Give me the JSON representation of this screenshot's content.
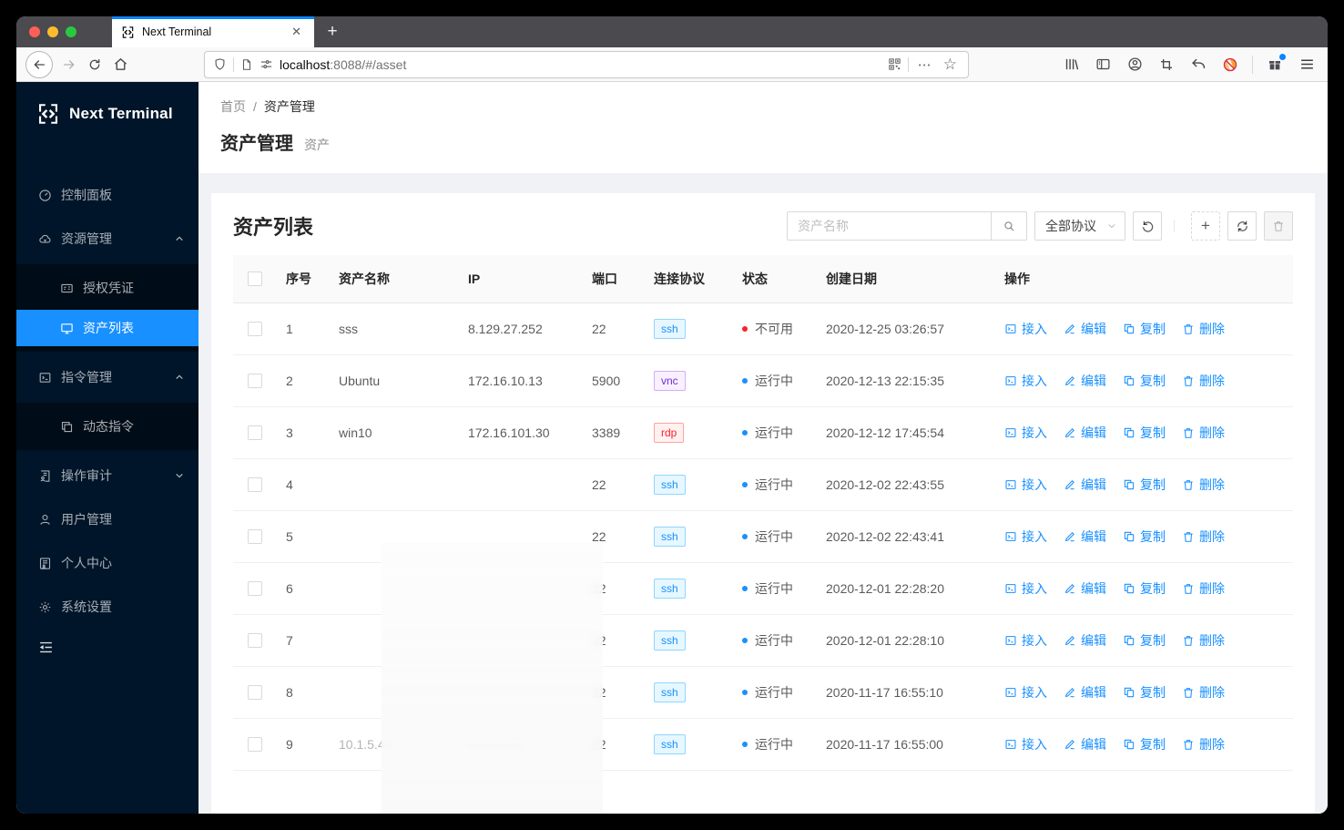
{
  "browser": {
    "tab_title": "Next Terminal",
    "url_host": "localhost",
    "url_rest": ":8088/#/asset"
  },
  "icons": {
    "close": "✕",
    "new_tab": "+",
    "more": "⋯",
    "star": "☆",
    "plus": "+"
  },
  "sidebar": {
    "logo_text": "Next Terminal",
    "items": [
      {
        "label": "控制面板"
      },
      {
        "label": "资源管理"
      },
      {
        "label": "授权凭证"
      },
      {
        "label": "资产列表"
      },
      {
        "label": "指令管理"
      },
      {
        "label": "动态指令"
      },
      {
        "label": "操作审计"
      },
      {
        "label": "用户管理"
      },
      {
        "label": "个人中心"
      },
      {
        "label": "系统设置"
      }
    ]
  },
  "breadcrumb": {
    "home": "首页",
    "separator": "/",
    "current": "资产管理"
  },
  "page_header": {
    "title": "资产管理",
    "subtitle": "资产"
  },
  "card": {
    "title": "资产列表",
    "search_placeholder": "资产名称",
    "protocol_filter": "全部协议"
  },
  "table": {
    "columns": [
      "序号",
      "资产名称",
      "IP",
      "端口",
      "连接协议",
      "状态",
      "创建日期",
      "操作"
    ],
    "actions": {
      "connect": "接入",
      "edit": "编辑",
      "copy": "复制",
      "delete": "删除"
    },
    "rows": [
      {
        "no": "1",
        "name": "sss",
        "ip": "8.129.27.252",
        "port": "22",
        "protocol": "ssh",
        "status": "不可用",
        "status_color": "#f5222d",
        "date": "2020-12-25 03:26:57",
        "faint": false
      },
      {
        "no": "2",
        "name": "Ubuntu",
        "ip": "172.16.10.13",
        "port": "5900",
        "protocol": "vnc",
        "status": "运行中",
        "status_color": "#1890ff",
        "date": "2020-12-13 22:15:35",
        "faint": false
      },
      {
        "no": "3",
        "name": "win10",
        "ip": "172.16.101.30",
        "port": "3389",
        "protocol": "rdp",
        "status": "运行中",
        "status_color": "#1890ff",
        "date": "2020-12-12 17:45:54",
        "faint": false
      },
      {
        "no": "4",
        "name": "",
        "ip": "",
        "port": "22",
        "protocol": "ssh",
        "status": "运行中",
        "status_color": "#1890ff",
        "date": "2020-12-02 22:43:55",
        "faint": false
      },
      {
        "no": "5",
        "name": "",
        "ip": "",
        "port": "22",
        "protocol": "ssh",
        "status": "运行中",
        "status_color": "#1890ff",
        "date": "2020-12-02 22:43:41",
        "faint": false
      },
      {
        "no": "6",
        "name": "",
        "ip": "",
        "port": "22",
        "protocol": "ssh",
        "status": "运行中",
        "status_color": "#1890ff",
        "date": "2020-12-01 22:28:20",
        "faint": false
      },
      {
        "no": "7",
        "name": "",
        "ip": "",
        "port": "22",
        "protocol": "ssh",
        "status": "运行中",
        "status_color": "#1890ff",
        "date": "2020-12-01 22:28:10",
        "faint": false
      },
      {
        "no": "8",
        "name": "",
        "ip": "",
        "port": "22",
        "protocol": "ssh",
        "status": "运行中",
        "status_color": "#1890ff",
        "date": "2020-11-17 16:55:10",
        "faint": false
      },
      {
        "no": "9",
        "name": "10.1.5.49",
        "ip": "10.1.5.49",
        "port": "22",
        "protocol": "ssh",
        "status": "运行中",
        "status_color": "#1890ff",
        "date": "2020-11-17 16:55:00",
        "faint": true
      }
    ]
  },
  "colors": {
    "accent": "#1890ff",
    "sidebar_bg": "#001529",
    "sidebar_submenu_bg": "#000c17",
    "content_bg": "#f0f2f5",
    "status_running": "#1890ff",
    "status_unavailable": "#f5222d",
    "tag_ssh": "#1890ff",
    "tag_vnc": "#722ed1",
    "tag_rdp": "#f5222d",
    "tab_accent": "#0a84ff"
  }
}
